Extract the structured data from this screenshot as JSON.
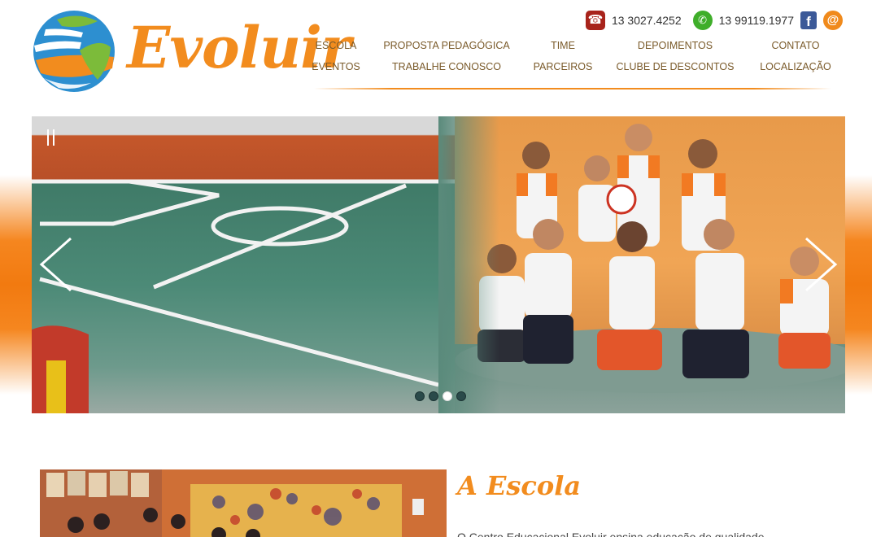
{
  "brand": {
    "name": "Evoluir"
  },
  "contact": {
    "phone": "13 3027.4252",
    "whatsapp": "13 99119.1977"
  },
  "nav": {
    "items": [
      "ESCOLA",
      "PROPOSTA PEDAGÓGICA",
      "TIME",
      "DEPOIMENTOS",
      "CONTATO",
      "EVENTOS",
      "TRABALHE CONOSCO",
      "PARCEIROS",
      "CLUBE DE DESCONTOS",
      "LOCALIZAÇÃO"
    ]
  },
  "slider": {
    "slide_count": 4,
    "active_index": 2
  },
  "section": {
    "title": "A Escola",
    "intro": "O Centro Educacional Evoluir ensina educação de qualidade"
  },
  "colors": {
    "accent": "#f28c1e",
    "nav_text": "#7a5a2a",
    "whatsapp": "#3fae2a",
    "facebook": "#3b5998"
  }
}
